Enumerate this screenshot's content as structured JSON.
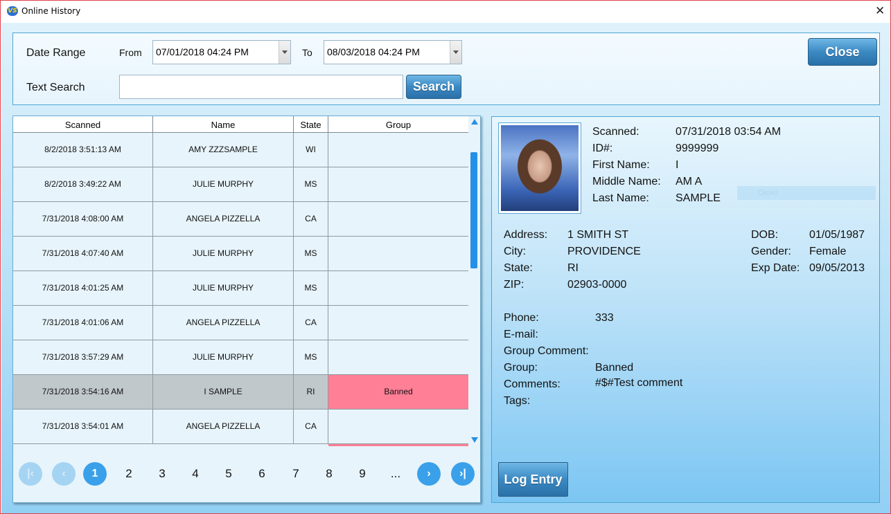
{
  "window": {
    "title": "Online History",
    "app_icon": "VS"
  },
  "filters": {
    "date_range_label": "Date Range",
    "from_label": "From",
    "from_value": "07/01/2018 04:24 PM",
    "to_label": "To",
    "to_value": "08/03/2018 04:24 PM",
    "text_search_label": "Text Search",
    "text_search_value": "",
    "search_button": "Search",
    "close_button": "Close"
  },
  "grid": {
    "columns": [
      "Scanned",
      "Name",
      "State",
      "Group"
    ],
    "rows": [
      {
        "scanned": "8/2/2018 3:51:13 AM",
        "name": "AMY ZZZSAMPLE",
        "state": "WI",
        "group": ""
      },
      {
        "scanned": "8/2/2018 3:49:22 AM",
        "name": "JULIE MURPHY",
        "state": "MS",
        "group": ""
      },
      {
        "scanned": "7/31/2018 4:08:00 AM",
        "name": "ANGELA PIZZELLA",
        "state": "CA",
        "group": ""
      },
      {
        "scanned": "7/31/2018 4:07:40 AM",
        "name": "JULIE MURPHY",
        "state": "MS",
        "group": ""
      },
      {
        "scanned": "7/31/2018 4:01:25 AM",
        "name": "JULIE MURPHY",
        "state": "MS",
        "group": ""
      },
      {
        "scanned": "7/31/2018 4:01:06 AM",
        "name": "ANGELA PIZZELLA",
        "state": "CA",
        "group": ""
      },
      {
        "scanned": "7/31/2018 3:57:29 AM",
        "name": "JULIE MURPHY",
        "state": "MS",
        "group": ""
      },
      {
        "scanned": "7/31/2018 3:54:16 AM",
        "name": "I SAMPLE",
        "state": "RI",
        "group": "Banned",
        "selected": true
      },
      {
        "scanned": "7/31/2018 3:54:01 AM",
        "name": "ANGELA PIZZELLA",
        "state": "CA",
        "group": ""
      }
    ]
  },
  "pager": {
    "first_icon": "first-page-icon",
    "prev_icon": "prev-page-icon",
    "next_icon": "next-page-icon",
    "last_icon": "last-page-icon",
    "current": "1",
    "pages": [
      "2",
      "3",
      "4",
      "5",
      "6",
      "7",
      "8",
      "9",
      "..."
    ]
  },
  "detail": {
    "scanned_label": "Scanned:",
    "scanned": "07/31/2018 03:54 AM",
    "id_label": "ID#:",
    "id": "9999999",
    "first_name_label": "First Name:",
    "first_name": "I",
    "middle_name_label": "Middle Name:",
    "middle_name": "AM A",
    "last_name_label": "Last Name:",
    "last_name": "SAMPLE",
    "address_label": "Address:",
    "address": "1 SMITH ST",
    "city_label": "City:",
    "city": "PROVIDENCE",
    "state_label": "State:",
    "state": "RI",
    "zip_label": "ZIP:",
    "zip": "02903-0000",
    "dob_label": "DOB:",
    "dob": "01/05/1987",
    "gender_label": "Gender:",
    "gender": "Female",
    "exp_label": "Exp Date:",
    "exp": "09/05/2013",
    "phone_label": "Phone:",
    "phone": "333",
    "email_label": "E-mail:",
    "email": "",
    "group_comment_label": "Group Comment:",
    "group_comment": "",
    "group_label": "Group:",
    "group": "Banned",
    "comments_label": "Comments:",
    "comments": "#$#Test comment",
    "tags_label": "Tags:",
    "tags": "",
    "ghost_text": "Окно",
    "log_entry_button": "Log Entry"
  },
  "colors": {
    "banned": "#ff7f96",
    "selected_row": "#c1c8cc",
    "accent": "#3aa0ea"
  }
}
